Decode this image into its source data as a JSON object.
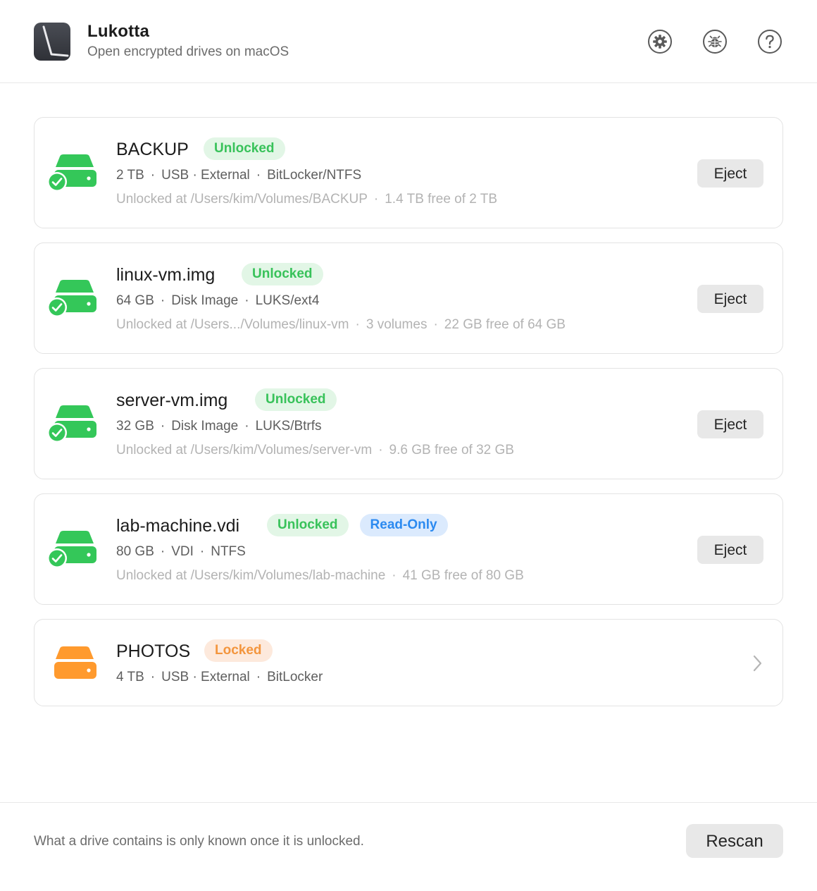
{
  "header": {
    "title": "Lukotta",
    "subtitle": "Open encrypted drives on macOS",
    "icons": [
      "settings-gear-icon",
      "bug-icon",
      "help-question-icon"
    ]
  },
  "colors": {
    "unlocked_green": "#34c759",
    "locked_orange": "#ff9a2e",
    "readonly_blue": "#2b8af0"
  },
  "drives": [
    {
      "name": "BACKUP",
      "badges": [
        "Unlocked"
      ],
      "status": "unlocked",
      "meta": [
        "2 TB",
        "USB · External",
        "BitLocker/NTFS"
      ],
      "details": [
        "Unlocked at /Users/kim/Volumes/BACKUP",
        "1.4 TB free of 2 TB"
      ],
      "action_label": "Eject"
    },
    {
      "name": "linux-vm.img",
      "badges": [
        "Unlocked"
      ],
      "status": "unlocked",
      "meta": [
        "64 GB",
        "Disk Image",
        "LUKS/ext4"
      ],
      "details": [
        "Unlocked at /Users.../Volumes/linux-vm",
        "3 volumes",
        "22 GB free of 64 GB"
      ],
      "action_label": "Eject"
    },
    {
      "name": "server-vm.img",
      "badges": [
        "Unlocked"
      ],
      "status": "unlocked",
      "meta": [
        "32 GB",
        "Disk Image",
        "LUKS/Btrfs"
      ],
      "details": [
        "Unlocked at /Users/kim/Volumes/server-vm",
        "9.6 GB free of 32 GB"
      ],
      "action_label": "Eject"
    },
    {
      "name": "lab-machine.vdi",
      "badges": [
        "Unlocked",
        "Read-Only"
      ],
      "status": "unlocked",
      "meta": [
        "80 GB",
        "VDI",
        "NTFS"
      ],
      "details": [
        "Unlocked at /Users/kim/Volumes/lab-machine",
        "41 GB free of 80 GB"
      ],
      "action_label": "Eject"
    },
    {
      "name": "PHOTOS",
      "badges": [
        "Locked"
      ],
      "status": "locked",
      "meta": [
        "4 TB",
        "USB · External",
        "BitLocker"
      ],
      "details": [],
      "action_label": ""
    }
  ],
  "footer": {
    "note": "What a drive contains is only known once it is unlocked.",
    "rescan_label": "Rescan"
  }
}
